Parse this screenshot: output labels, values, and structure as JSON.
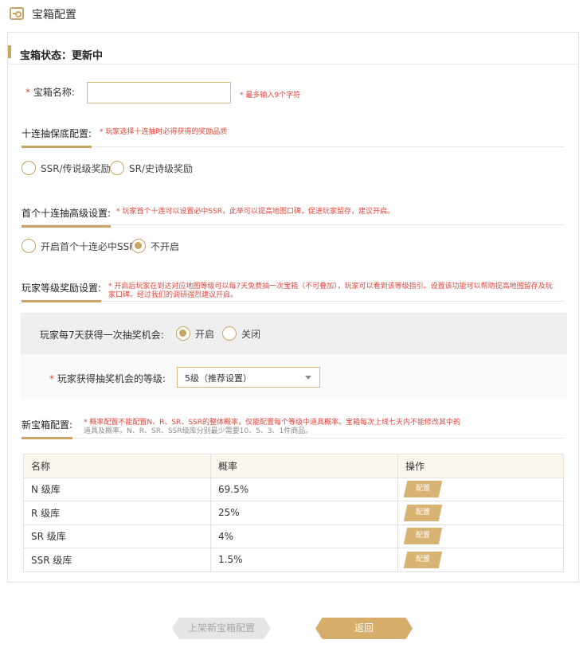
{
  "page": {
    "title": "宝箱配置",
    "title_icon": "chest-settings-icon"
  },
  "status": {
    "text": "宝箱状态：更新中"
  },
  "chest_name": {
    "required_mark": "*",
    "label": "宝箱名称:",
    "value": "",
    "placeholder": "",
    "hint": "* 最多输入9个字符"
  },
  "guarantee": {
    "title": "十连抽保底配置:",
    "desc": "* 玩家选择十连抽时必得获得的奖励品质",
    "options": [
      {
        "label": "SSR/传说级奖励",
        "selected": false
      },
      {
        "label": "SR/史诗级奖励",
        "selected": false
      }
    ]
  },
  "first_ten": {
    "title": "首个十连抽高级设置:",
    "desc": "* 玩家首个十连可以设置必中SSR，此举可以提高地图口碑，促进玩家留存，建议开启。",
    "options": [
      {
        "label": "开启首个十连必中SSR",
        "selected": false
      },
      {
        "label": "不开启",
        "selected": true
      }
    ]
  },
  "level_reward": {
    "title": "玩家等级奖励设置:",
    "desc_line1": "* 开启后玩家在到达对应地图等级可以每7天免费抽一次宝箱（不可叠加），玩家可以看到该等级指引。设置该功能可以帮助提高地图留存及玩",
    "desc_line2": "家口碑。经过我们的调研强烈建议开启。",
    "weekly_label": "玩家每7天获得一次抽奖机会:",
    "weekly_options": [
      {
        "label": "开启",
        "selected": true
      },
      {
        "label": "关闭",
        "selected": false
      }
    ],
    "level_required_mark": "*",
    "level_label": "玩家获得抽奖机会的等级:",
    "level_value": "5级（推荐设置）"
  },
  "new_chest": {
    "title": "新宝箱配置:",
    "desc_line1": "* 概率配置不能配置N、R、SR、SSR的整体概率，仅能配置每个等级中道具概率。宝箱每次上线七天内不能修改其中的",
    "desc_line2": "道具及概率。N、R、SR、SSR级库分别最少需要10、5、3、1件商品。",
    "columns": [
      "名称",
      "概率",
      "操作"
    ],
    "rows": [
      {
        "name": "N 级库",
        "prob": "69.5%",
        "action": "配置"
      },
      {
        "name": "R 级库",
        "prob": "25%",
        "action": "配置"
      },
      {
        "name": "SR 级库",
        "prob": "4%",
        "action": "配置"
      },
      {
        "name": "SSR 级库",
        "prob": "1.5%",
        "action": "配置"
      }
    ]
  },
  "footer": {
    "publish_label": "上架新宝箱配置",
    "back_label": "返回"
  },
  "colors": {
    "accent": "#c9a463",
    "button": "#d6ad6a",
    "required": "#e0473c"
  }
}
